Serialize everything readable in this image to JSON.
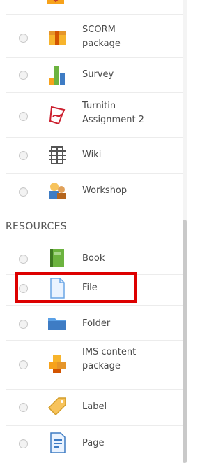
{
  "activities": [
    {
      "label": "SCORM\npackage",
      "icon": "scorm-package-icon"
    },
    {
      "label": "Survey",
      "icon": "survey-chart-icon"
    },
    {
      "label": "Turnitin\nAssignment 2",
      "icon": "turnitin-icon"
    },
    {
      "label": "Wiki",
      "icon": "wiki-icon"
    },
    {
      "label": "Workshop",
      "icon": "workshop-icon"
    }
  ],
  "resources_heading": "RESOURCES",
  "resources": [
    {
      "label": "Book",
      "icon": "book-icon"
    },
    {
      "label": "File",
      "icon": "file-icon"
    },
    {
      "label": "Folder",
      "icon": "folder-icon"
    },
    {
      "label": "IMS content\npackage",
      "icon": "ims-package-icon"
    },
    {
      "label": "Label",
      "icon": "label-tag-icon"
    },
    {
      "label": "Page",
      "icon": "page-icon"
    }
  ],
  "colors": {
    "highlight": "#dd0000",
    "accent": "#f7a21b"
  }
}
